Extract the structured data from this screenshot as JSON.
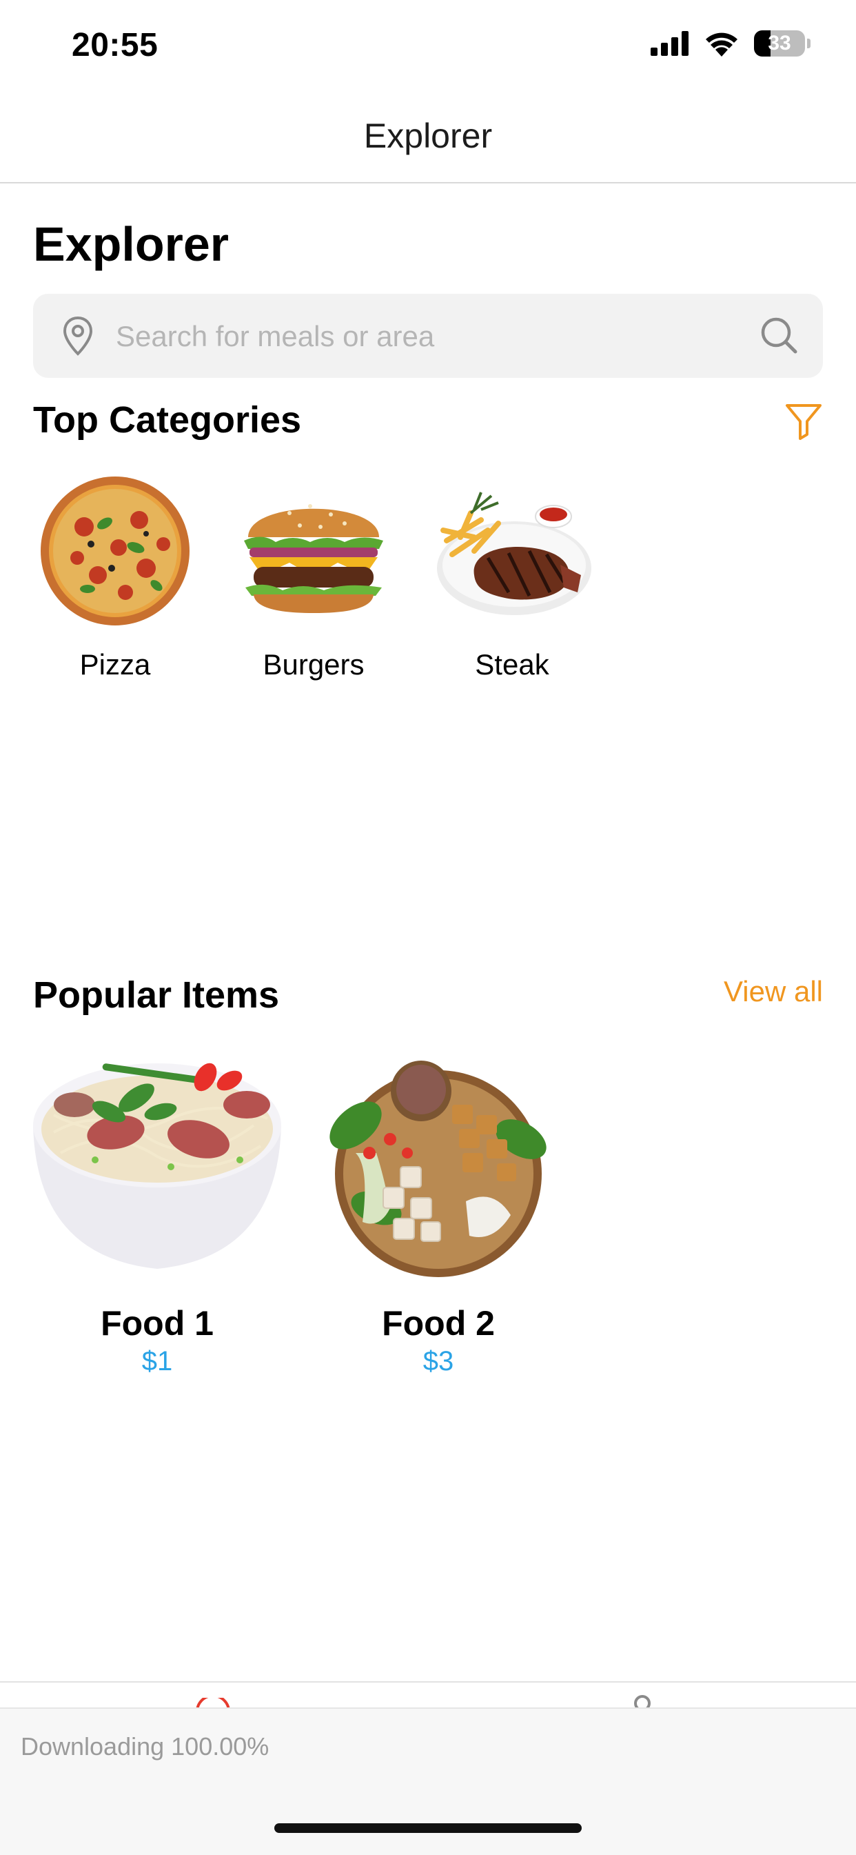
{
  "status_bar": {
    "time": "20:55",
    "battery": "33",
    "battery_level": 0.33
  },
  "nav": {
    "title": "Explorer"
  },
  "page": {
    "title": "Explorer"
  },
  "search": {
    "placeholder": "Search for meals or area",
    "value": ""
  },
  "categories": {
    "title": "Top Categories",
    "items": [
      {
        "label": "Pizza"
      },
      {
        "label": "Burgers"
      },
      {
        "label": "Steak"
      }
    ]
  },
  "popular": {
    "title": "Popular Items",
    "view_all": "View all",
    "items": [
      {
        "name": "Food 1",
        "price": "$1"
      },
      {
        "name": "Food 2",
        "price": "$3"
      }
    ]
  },
  "download": {
    "text": "Downloading 100.00%"
  },
  "colors": {
    "accent": "#f0961f",
    "price": "#2aa3e6",
    "search_bg": "#f2f2f2"
  },
  "icons": [
    "location-pin-icon",
    "search-icon",
    "filter-icon",
    "cellular-icon",
    "wifi-icon",
    "battery-icon"
  ]
}
